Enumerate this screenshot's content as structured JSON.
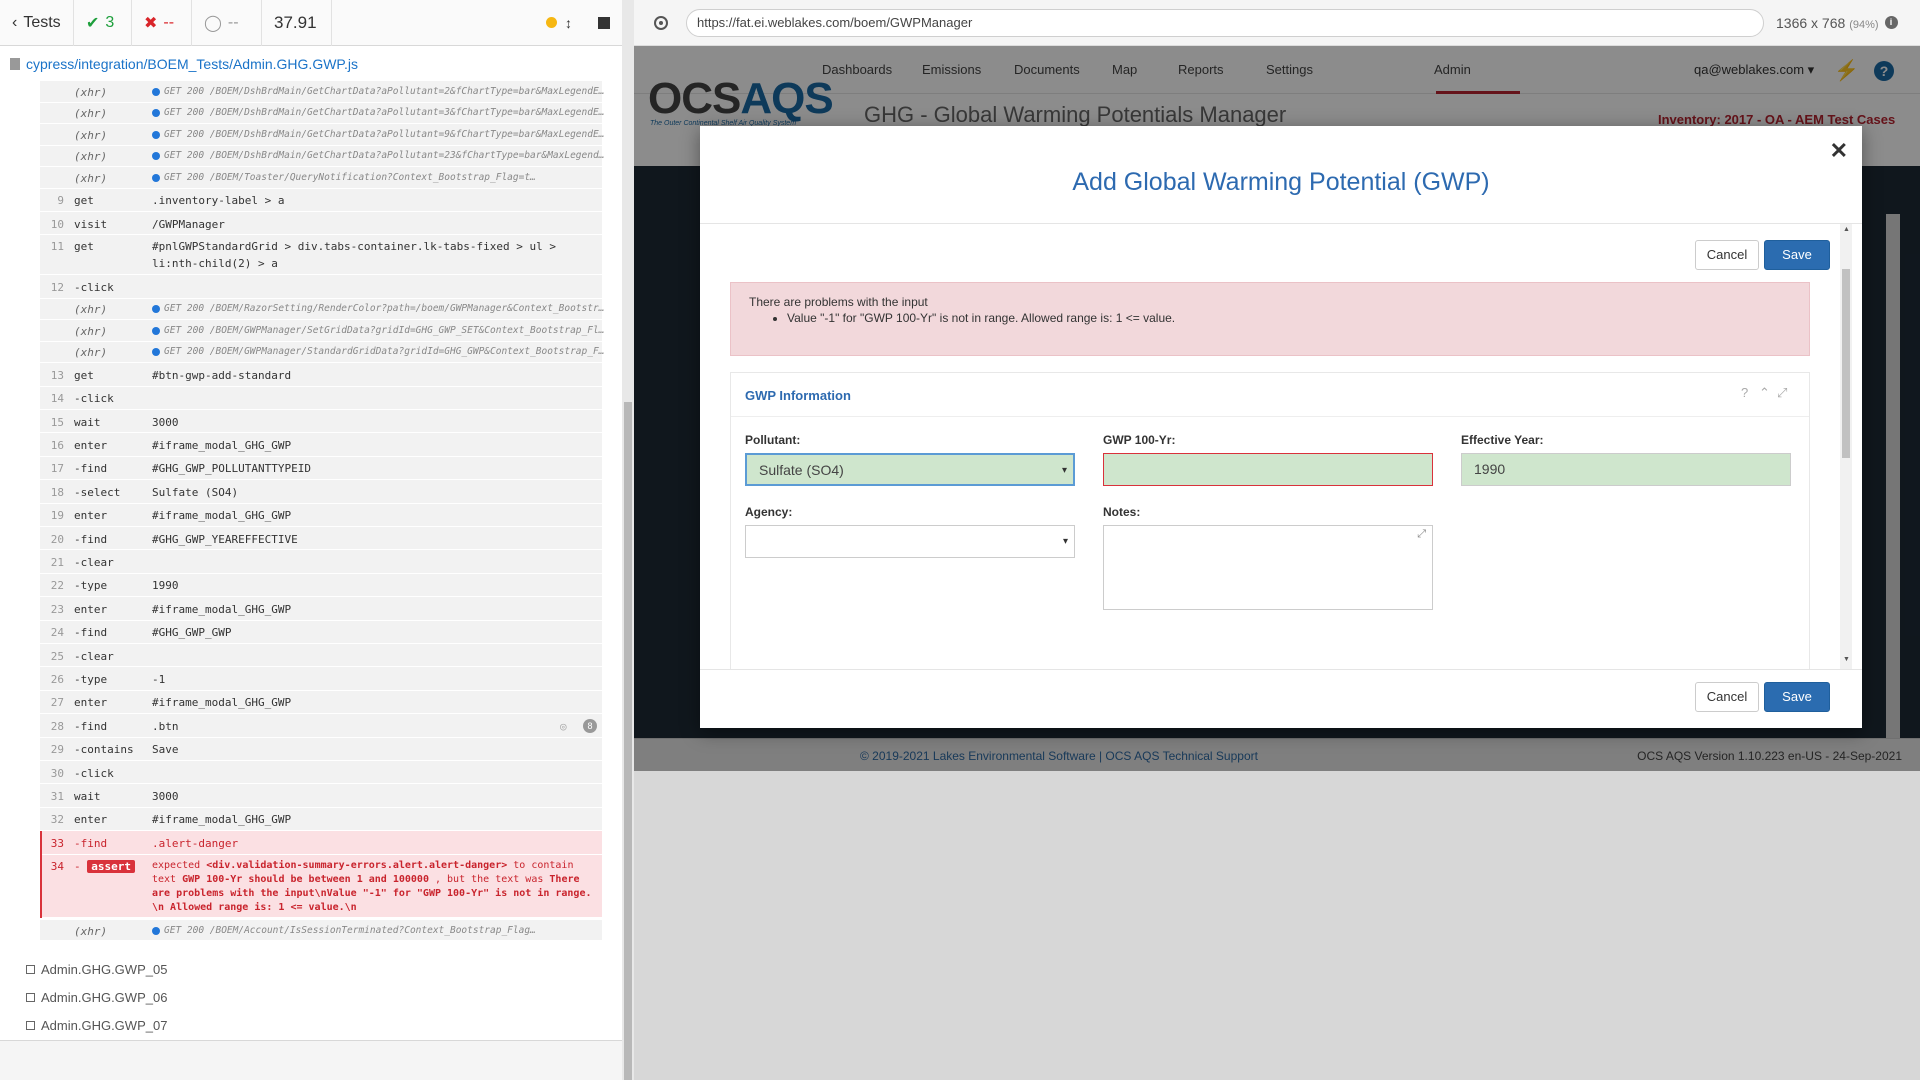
{
  "topbar": {
    "back_label": "Tests",
    "passed": "3",
    "failed": "--",
    "pending": "--",
    "duration": "37.91"
  },
  "spec": {
    "path": "cypress/integration/BOEM_Tests/Admin.GHG.GWP.js"
  },
  "log": [
    {
      "num": "",
      "cmd": "(xhr)",
      "msg": "GET 200 /BOEM/DshBrdMain/GetChartData?aPollutant=2&fChartType=bar&MaxLegendE…",
      "xhr": true
    },
    {
      "num": "",
      "cmd": "(xhr)",
      "msg": "GET 200 /BOEM/DshBrdMain/GetChartData?aPollutant=3&fChartType=bar&MaxLegendE…",
      "xhr": true
    },
    {
      "num": "",
      "cmd": "(xhr)",
      "msg": "GET 200 /BOEM/DshBrdMain/GetChartData?aPollutant=9&fChartType=bar&MaxLegendE…",
      "xhr": true
    },
    {
      "num": "",
      "cmd": "(xhr)",
      "msg": "GET 200 /BOEM/DshBrdMain/GetChartData?aPollutant=23&fChartType=bar&MaxLegend…",
      "xhr": true
    },
    {
      "num": "",
      "cmd": "(xhr)",
      "msg": "GET 200 /BOEM/Toaster/QueryNotification?Context_Bootstrap_Flag=t…",
      "xhr": true
    },
    {
      "num": "9",
      "cmd": "get",
      "msg": ".inventory-label > a"
    },
    {
      "num": "10",
      "cmd": "visit",
      "msg": "/GWPManager"
    },
    {
      "num": "11",
      "cmd": "get",
      "msg": "#pnlGWPStandardGrid > div.tabs-container.lk-tabs-fixed > ul >",
      "msg2": "li:nth-child(2) > a",
      "tall": true
    },
    {
      "num": "12",
      "cmd": "-click",
      "msg": ""
    },
    {
      "num": "",
      "cmd": "(xhr)",
      "msg": "GET 200 /BOEM/RazorSetting/RenderColor?path=/boem/GWPManager&Context_Bootstr…",
      "xhr": true
    },
    {
      "num": "",
      "cmd": "(xhr)",
      "msg": "GET 200 /BOEM/GWPManager/SetGridData?gridId=GHG_GWP_SET&Context_Bootstrap_Fl…",
      "xhr": true
    },
    {
      "num": "",
      "cmd": "(xhr)",
      "msg": "GET 200 /BOEM/GWPManager/StandardGridData?gridId=GHG_GWP&Context_Bootstrap_F…",
      "xhr": true
    },
    {
      "num": "13",
      "cmd": "get",
      "msg": "#btn-gwp-add-standard"
    },
    {
      "num": "14",
      "cmd": "-click",
      "msg": ""
    },
    {
      "num": "15",
      "cmd": "wait",
      "msg": "3000"
    },
    {
      "num": "16",
      "cmd": "enter",
      "msg": "#iframe_modal_GHG_GWP"
    },
    {
      "num": "17",
      "cmd": "-find",
      "msg": "#GHG_GWP_POLLUTANTTYPEID"
    },
    {
      "num": "18",
      "cmd": "-select",
      "msg": "Sulfate (SO4)"
    },
    {
      "num": "19",
      "cmd": "enter",
      "msg": "#iframe_modal_GHG_GWP"
    },
    {
      "num": "20",
      "cmd": "-find",
      "msg": "#GHG_GWP_YEAREFFECTIVE"
    },
    {
      "num": "21",
      "cmd": "-clear",
      "msg": ""
    },
    {
      "num": "22",
      "cmd": "-type",
      "msg": "1990"
    },
    {
      "num": "23",
      "cmd": "enter",
      "msg": "#iframe_modal_GHG_GWP"
    },
    {
      "num": "24",
      "cmd": "-find",
      "msg": "#GHG_GWP_GWP"
    },
    {
      "num": "25",
      "cmd": "-clear",
      "msg": ""
    },
    {
      "num": "26",
      "cmd": "-type",
      "msg": "-1"
    },
    {
      "num": "27",
      "cmd": "enter",
      "msg": "#iframe_modal_GHG_GWP"
    },
    {
      "num": "28",
      "cmd": "-find",
      "msg": ".btn",
      "badge": "8"
    },
    {
      "num": "29",
      "cmd": "-contains",
      "msg": "Save"
    },
    {
      "num": "30",
      "cmd": "-click",
      "msg": ""
    },
    {
      "num": "31",
      "cmd": "wait",
      "msg": "3000"
    },
    {
      "num": "32",
      "cmd": "enter",
      "msg": "#iframe_modal_GHG_GWP"
    },
    {
      "num": "33",
      "cmd": "-find",
      "msg": ".alert-danger",
      "err": true
    }
  ],
  "assert_row": {
    "num": "34",
    "badge": "assert",
    "text_expected": "expected",
    "text_el": "<div.validation-summary-errors.alert.alert-danger>",
    "text_mid": "to contain text",
    "text_want": "GWP 100-Yr should be between 1 and 100000",
    "text_but": ", but the text was",
    "text_got": "There are problems with the input\\nValue \"-1\" for \"GWP 100-Yr\" is not in range. \\n Allowed range is: 1 <= value.\\n"
  },
  "last_xhr": {
    "cmd": "(xhr)",
    "msg": "GET 200 /BOEM/Account/IsSessionTerminated?Context_Bootstrap_Flag…"
  },
  "tests": [
    "Admin.GHG.GWP_05",
    "Admin.GHG.GWP_06",
    "Admin.GHG.GWP_07"
  ],
  "browser": {
    "url": "https://fat.ei.weblakes.com/boem/GWPManager",
    "viewport": "1366 x 768",
    "zoom": "(94%)"
  },
  "app": {
    "logo_a": "OCS",
    "logo_b": "AQS",
    "logo_sub": "The Outer Continental Shelf Air Quality System",
    "nav": [
      "Dashboards",
      "Emissions",
      "Documents",
      "Map",
      "Reports",
      "Settings",
      "Admin"
    ],
    "user": "qa@weblakes.com ▾",
    "page_title": "GHG - Global Warming Potentials Manager",
    "inventory": "Inventory: 2017 - OA - AEM Test Cases",
    "footer_left": "© 2019-2021 Lakes Environmental Software | OCS AQS Technical Support",
    "footer_right": "OCS AQS Version 1.10.223 en-US - 24-Sep-2021"
  },
  "modal": {
    "title": "Add Global Warming Potential (GWP)",
    "cancel": "Cancel",
    "save": "Save",
    "alert_head": "There are problems with the input",
    "alert_item": "Value \"-1\" for \"GWP 100-Yr\" is not in range. Allowed range is: 1 <= value.",
    "panel_title": "GWP Information",
    "pollutant_label": "Pollutant:",
    "pollutant_value": "Sulfate (SO4)",
    "gwp_label": "GWP 100-Yr:",
    "gwp_value": "",
    "year_label": "Effective Year:",
    "year_value": "1990",
    "agency_label": "Agency:",
    "agency_value": "",
    "notes_label": "Notes:"
  },
  "colors": {
    "accent": "#2d6ab0",
    "danger": "#d9323b",
    "pass": "#1e9f3c"
  }
}
